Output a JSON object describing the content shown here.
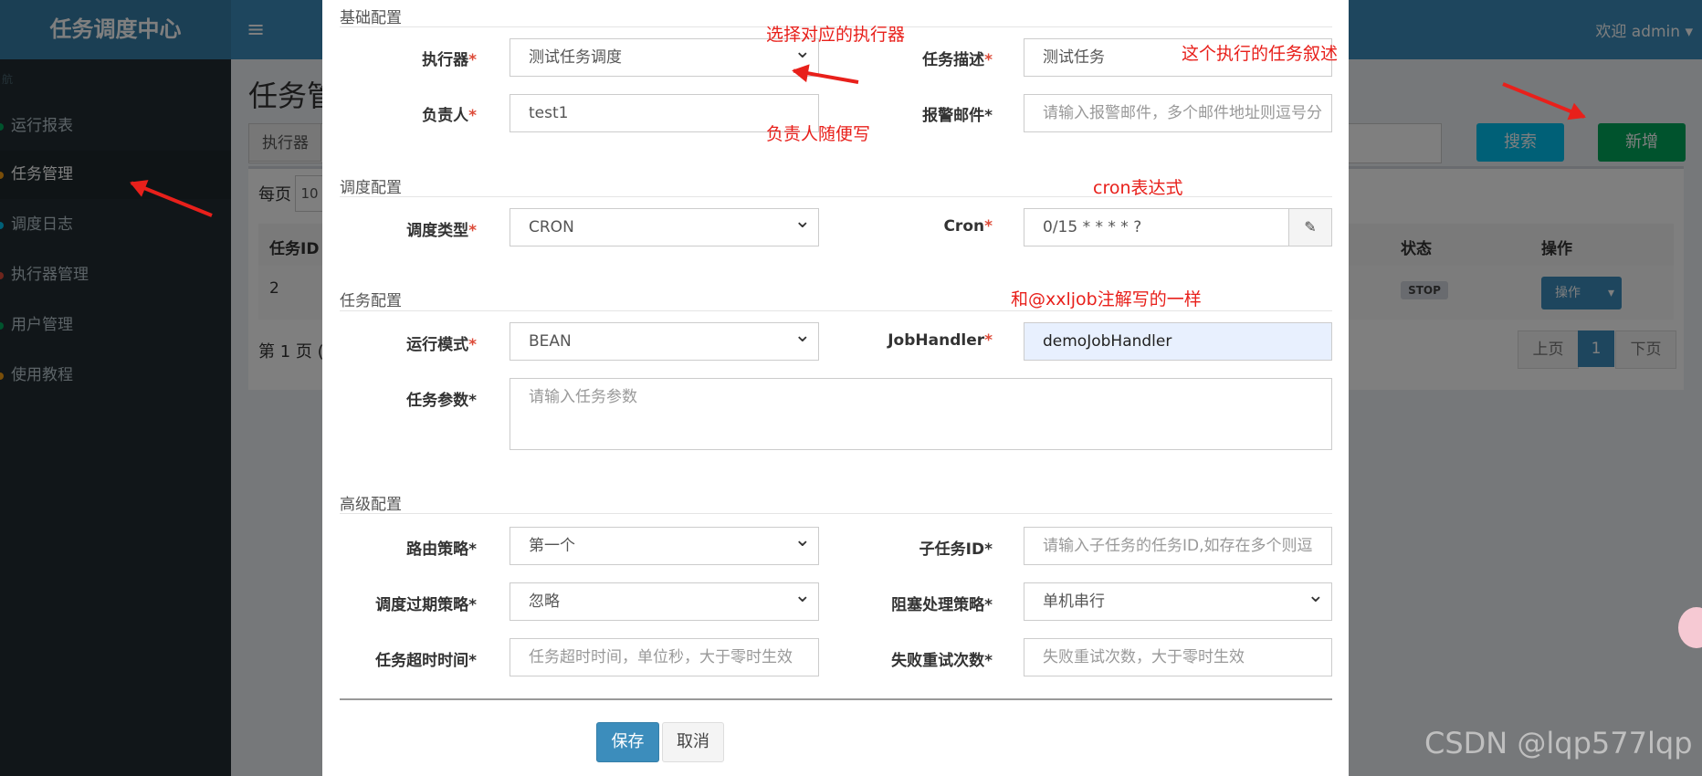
{
  "app": {
    "title": "任务调度中心",
    "welcome": "欢迎 admin"
  },
  "sidebar": {
    "header": "航",
    "items": [
      {
        "label": "运行报表",
        "dot": "#00a65a"
      },
      {
        "label": "任务管理",
        "dot": "#f39c12"
      },
      {
        "label": "调度日志",
        "dot": "#00c0ef"
      },
      {
        "label": "执行器管理",
        "dot": "#dd4b39"
      },
      {
        "label": "用户管理",
        "dot": "#00a65a"
      },
      {
        "label": "使用教程",
        "dot": "#f39c12"
      }
    ]
  },
  "background": {
    "page_title": "任务管",
    "executor_filter": "执行器",
    "per_page": "每页",
    "per_page_value": "10",
    "search_button": "搜索",
    "add_button": "新增",
    "table_headers": {
      "id": "任务ID",
      "status": "状态",
      "action": "操作"
    },
    "row": {
      "id": "2",
      "status": "STOP",
      "action": "操作"
    },
    "pagination_info": "第 1 页 (",
    "prev": "上页",
    "page": "1",
    "next": "下页"
  },
  "modal": {
    "sections": {
      "basic": "基础配置",
      "schedule": "调度配置",
      "task": "任务配置",
      "advanced": "高级配置"
    },
    "fields": {
      "executor": {
        "label": "执行器",
        "value": "测试任务调度"
      },
      "desc": {
        "label": "任务描述",
        "value": "测试任务"
      },
      "owner": {
        "label": "负责人",
        "value": "test1"
      },
      "email": {
        "label": "报警邮件*",
        "placeholder": "请输入报警邮件，多个邮件地址则逗号分"
      },
      "schedule_type": {
        "label": "调度类型",
        "value": "CRON"
      },
      "cron": {
        "label": "Cron",
        "value": "0/15 * * * * ?"
      },
      "run_mode": {
        "label": "运行模式",
        "value": "BEAN"
      },
      "job_handler": {
        "label": "JobHandler",
        "value": "demoJobHandler"
      },
      "params": {
        "label": "任务参数*",
        "placeholder": "请输入任务参数"
      },
      "route": {
        "label": "路由策略*",
        "value": "第一个"
      },
      "child_id": {
        "label": "子任务ID*",
        "placeholder": "请输入子任务的任务ID,如存在多个则逗"
      },
      "expire": {
        "label": "调度过期策略*",
        "value": "忽略"
      },
      "block": {
        "label": "阻塞处理策略*",
        "value": "单机串行"
      },
      "timeout": {
        "label": "任务超时时间*",
        "placeholder": "任务超时时间，单位秒，大于零时生效"
      },
      "retry": {
        "label": "失败重试次数*",
        "placeholder": "失败重试次数，大于零时生效"
      }
    },
    "save": "保存",
    "cancel": "取消"
  },
  "annotations": {
    "executor": "选择对应的执行器",
    "desc": "这个执行的任务叙述",
    "owner": "负责人随便写",
    "cron": "cron表达式",
    "handler": "和@xxljob注解写的一样"
  },
  "watermark": "CSDN @lqp577lqp"
}
